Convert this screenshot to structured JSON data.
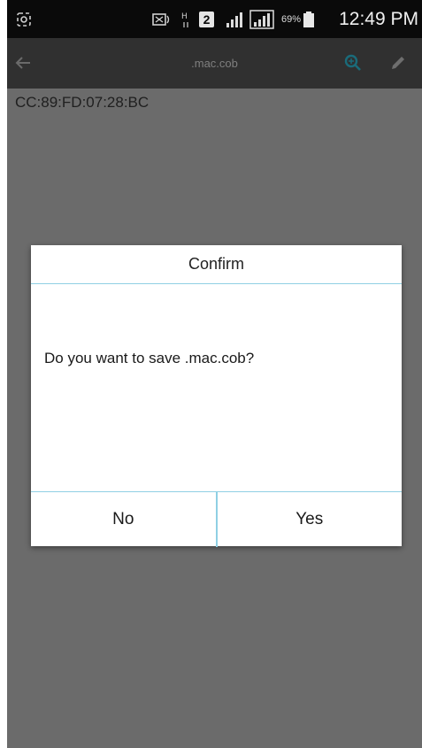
{
  "status_bar": {
    "battery_percent": "69%",
    "sim_slot": "2",
    "time": "12:49 PM"
  },
  "toolbar": {
    "title": ".mac.cob",
    "back_icon": "arrow-left-icon",
    "search_icon": "search-icon",
    "edit_icon": "pencil-icon"
  },
  "content": {
    "mac_address": "CC:89:FD:07:28:BC"
  },
  "dialog": {
    "title": "Confirm",
    "message": "Do you want to save .mac.cob?",
    "no_label": "No",
    "yes_label": "Yes"
  },
  "colors": {
    "status_bar_bg": "#0a0a0a",
    "toolbar_bg": "#303030",
    "dimmed_content_bg": "#6b6b6b",
    "dialog_divider": "#8fd0e4",
    "accent_teal": "#1a6b7a"
  }
}
